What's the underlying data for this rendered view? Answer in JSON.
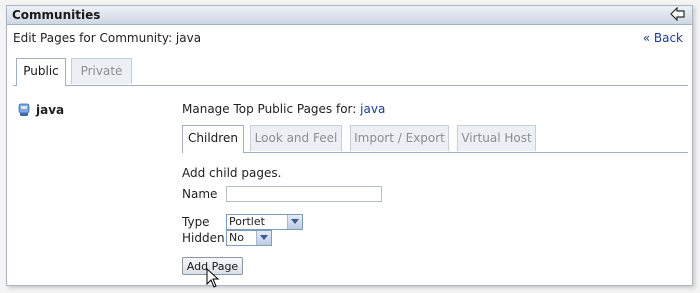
{
  "portlet": {
    "title": "Communities",
    "back_icon": "back-arrow-icon"
  },
  "page": {
    "heading": "Edit Pages for Community: java",
    "back_quote": "«",
    "back_label": "Back"
  },
  "tabs": [
    {
      "label": "Public",
      "active": true
    },
    {
      "label": "Private",
      "active": false
    }
  ],
  "community": {
    "icon": "community-icon",
    "name": "java"
  },
  "manage": {
    "prefix": "Manage Top Public Pages for:",
    "community_link": "java"
  },
  "inner_tabs": [
    {
      "label": "Children",
      "active": true
    },
    {
      "label": "Look and Feel",
      "active": false
    },
    {
      "label": "Import / Export",
      "active": false
    },
    {
      "label": "Virtual Host",
      "active": false
    }
  ],
  "form": {
    "intro": "Add child pages.",
    "name_label": "Name",
    "name_value": "",
    "type_label": "Type",
    "type_value": "Portlet",
    "hidden_label": "Hidden",
    "hidden_value": "No",
    "submit_label": "Add Page"
  }
}
